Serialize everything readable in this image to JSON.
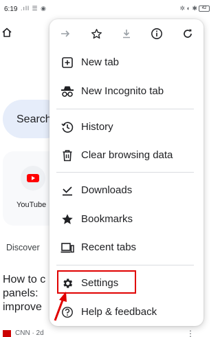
{
  "status_bar": {
    "time": "6:19",
    "left_icons": ".ıll ☰ ◉",
    "right_icons": "✲ ◐ ✱",
    "battery": "42"
  },
  "background": {
    "search_text": "Search",
    "shortcut_label": "YouTube",
    "discover_label": "Discover",
    "article_title": "How to c panels: improve",
    "source_text": "CNN · 2d"
  },
  "menu": {
    "toolbar": {
      "forward": "forward-arrow-icon",
      "bookmark": "star-icon",
      "download": "download-icon",
      "info": "info-icon",
      "reload": "reload-icon"
    },
    "items": [
      {
        "label": "New tab",
        "icon": "new-tab-icon"
      },
      {
        "label": "New Incognito tab",
        "icon": "incognito-icon"
      },
      {
        "label": "History",
        "icon": "history-icon"
      },
      {
        "label": "Clear browsing data",
        "icon": "trash-icon"
      },
      {
        "label": "Downloads",
        "icon": "download-check-icon"
      },
      {
        "label": "Bookmarks",
        "icon": "star-filled-icon"
      },
      {
        "label": "Recent tabs",
        "icon": "recent-tabs-icon"
      },
      {
        "label": "Settings",
        "icon": "gear-icon"
      },
      {
        "label": "Help & feedback",
        "icon": "help-icon"
      }
    ]
  },
  "annotation": {
    "highlight_color": "#e00000"
  }
}
